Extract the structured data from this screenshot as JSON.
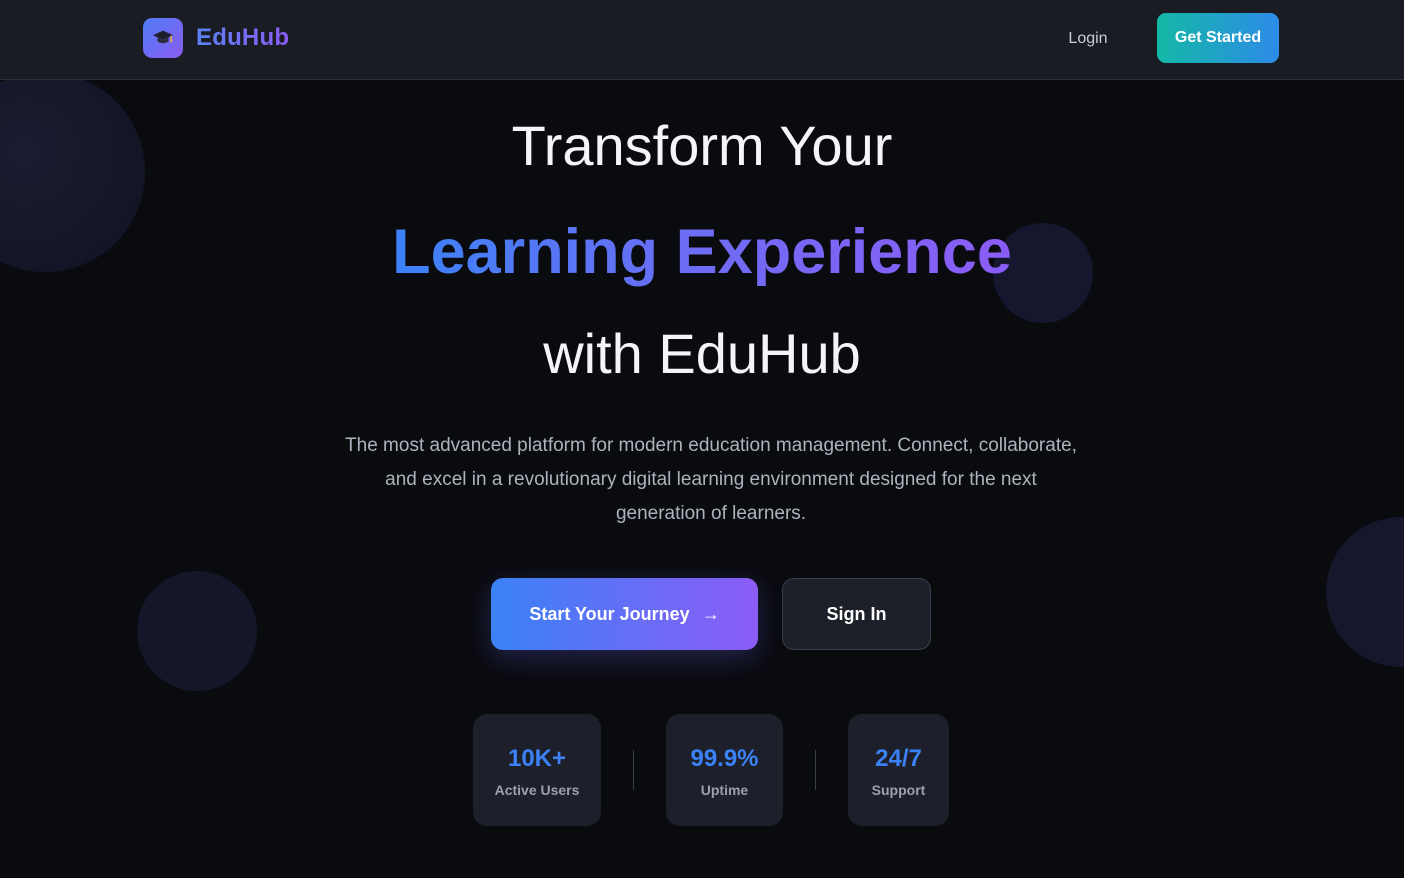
{
  "brand": {
    "name": "EduHub",
    "logo_icon": "graduation-cap-icon",
    "colors": {
      "start": "#4f7cf6",
      "end": "#8b5cf6"
    }
  },
  "nav": {
    "login_label": "Login",
    "cta_label": "Get Started",
    "cta_colors": {
      "start": "#14b8a6",
      "end": "#2d8be8"
    }
  },
  "hero": {
    "line1": "Transform Your",
    "line2": "Learning Experience",
    "line3": "with EduHub",
    "description": "The most advanced platform for modern education management. Connect, collaborate, and excel in a revolutionary digital learning environment designed for the next generation of learners.",
    "accent_gradient": {
      "start": "#3b82f6",
      "end": "#8b5cf6"
    }
  },
  "actions": {
    "primary_label": "Start Your Journey",
    "primary_icon": "arrow-right-icon",
    "secondary_label": "Sign In"
  },
  "stats": [
    {
      "value": "10K+",
      "label": "Active Users"
    },
    {
      "value": "99.9%",
      "label": "Uptime"
    },
    {
      "value": "24/7",
      "label": "Support"
    }
  ],
  "theme": {
    "background": "#0a0b0f",
    "header_bg": "#1a1c24",
    "stat_value_color": "#3b82f6"
  }
}
